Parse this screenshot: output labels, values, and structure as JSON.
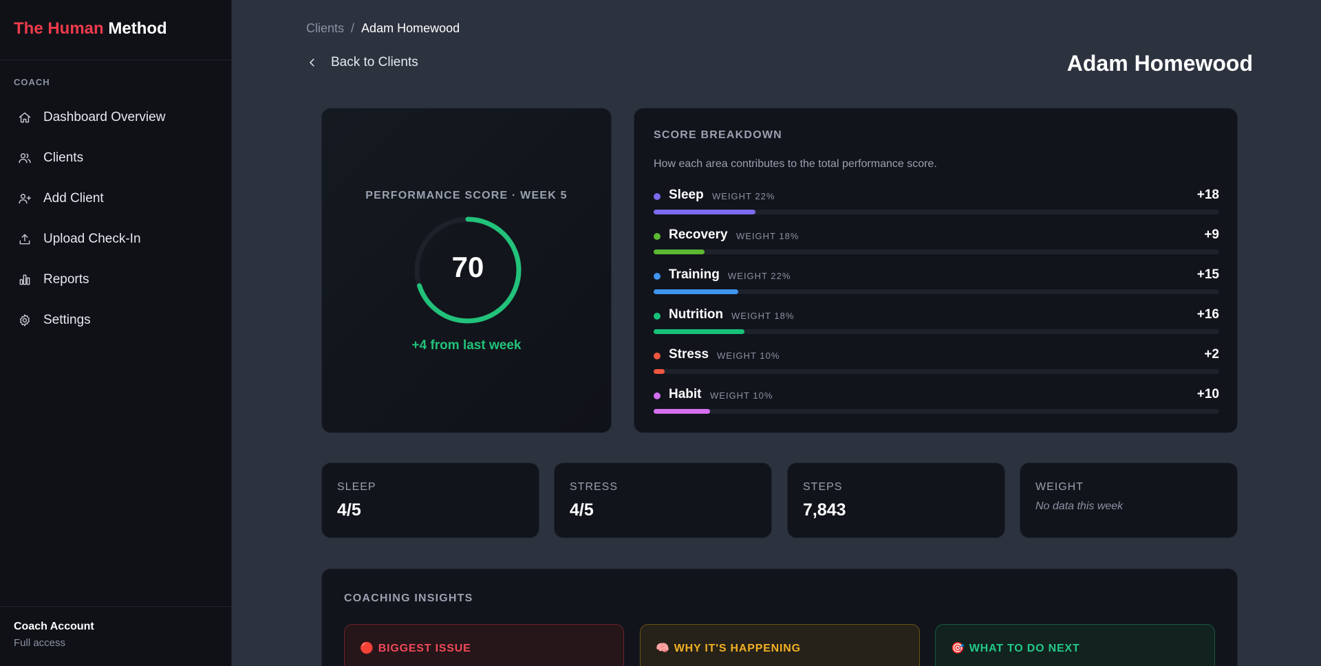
{
  "brand": {
    "part1": "The Human",
    "part2": "Method"
  },
  "sidebar": {
    "section": "COACH",
    "items": [
      {
        "label": "Dashboard Overview",
        "icon": "home-icon"
      },
      {
        "label": "Clients",
        "icon": "users-icon"
      },
      {
        "label": "Add Client",
        "icon": "user-plus-icon"
      },
      {
        "label": "Upload Check-In",
        "icon": "upload-icon"
      },
      {
        "label": "Reports",
        "icon": "bar-chart-icon"
      },
      {
        "label": "Settings",
        "icon": "gear-icon"
      }
    ],
    "account": {
      "title": "Coach Account",
      "subtitle": "Full access"
    }
  },
  "breadcrumb": {
    "parent": "Clients",
    "separator": "/",
    "current": "Adam Homewood"
  },
  "back_label": "Back to Clients",
  "client_name": "Adam Homewood",
  "score": {
    "label": "PERFORMANCE SCORE · WEEK 5",
    "value": "70",
    "progress": 0.7,
    "delta": "+4 from last week",
    "color": "#22c27a"
  },
  "breakdown": {
    "title": "SCORE BREAKDOWN",
    "subtitle": "How each area contributes to the total performance score.",
    "items": [
      {
        "name": "Sleep",
        "weight": "WEIGHT 22%",
        "value": "+18",
        "fill": 0.18,
        "color": "#7b6cf0"
      },
      {
        "name": "Recovery",
        "weight": "WEIGHT 18%",
        "value": "+9",
        "fill": 0.09,
        "color": "#5cb832"
      },
      {
        "name": "Training",
        "weight": "WEIGHT 22%",
        "value": "+15",
        "fill": 0.15,
        "color": "#3f95ee"
      },
      {
        "name": "Nutrition",
        "weight": "WEIGHT 18%",
        "value": "+16",
        "fill": 0.16,
        "color": "#17c27a"
      },
      {
        "name": "Stress",
        "weight": "WEIGHT 10%",
        "value": "+2",
        "fill": 0.02,
        "color": "#f0563f"
      },
      {
        "name": "Habit",
        "weight": "WEIGHT 10%",
        "value": "+10",
        "fill": 0.1,
        "color": "#d36ff0"
      }
    ]
  },
  "metrics": [
    {
      "label": "SLEEP",
      "value": "4/5"
    },
    {
      "label": "STRESS",
      "value": "4/5"
    },
    {
      "label": "STEPS",
      "value": "7,843"
    },
    {
      "label": "WEIGHT",
      "note": "No data this week"
    }
  ],
  "insights": {
    "title": "COACHING INSIGHTS",
    "boxes": [
      {
        "emoji": "🔴",
        "label": "BIGGEST ISSUE"
      },
      {
        "emoji": "🧠",
        "label": "WHY IT'S HAPPENING"
      },
      {
        "emoji": "🎯",
        "label": "WHAT TO DO NEXT"
      }
    ]
  }
}
